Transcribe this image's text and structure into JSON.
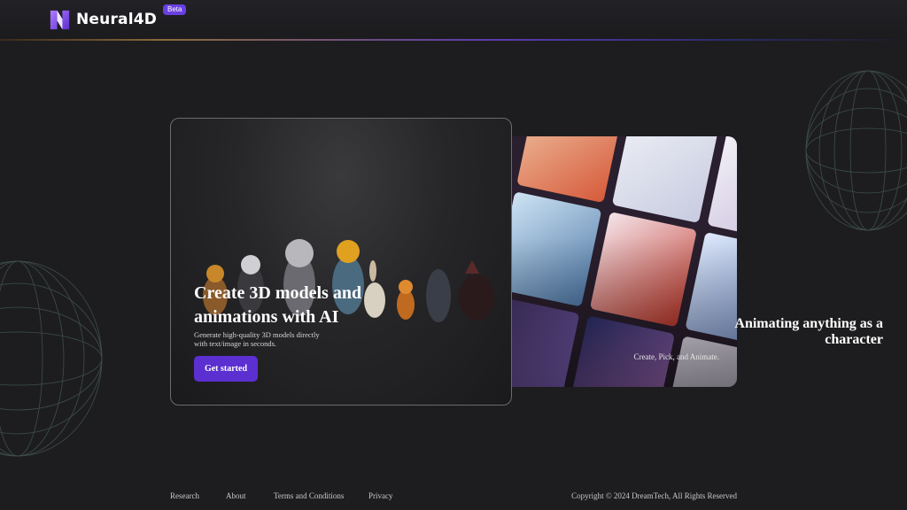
{
  "header": {
    "logo_text": "Neural4D",
    "badge": "Beta"
  },
  "hero_card": {
    "title": "Create 3D models and animations with AI",
    "subtitle": "Generate high-quality 3D models directly with text/image in seconds.",
    "button_label": "Get started"
  },
  "feature_card": {
    "title": "Animating anything as a character",
    "subtitle": "Create, Pick, and Animate."
  },
  "footer": {
    "links": [
      "Research",
      "About",
      "Terms and Conditions",
      "Privacy"
    ],
    "copyright": "Copyright © 2024 DreamTech, All Rights Reserved"
  },
  "colors": {
    "background": "#1d1d1f",
    "accent": "#5b2fd0",
    "badge": "#6a3fe0"
  },
  "icons": [
    "neural4d-logo-icon"
  ]
}
